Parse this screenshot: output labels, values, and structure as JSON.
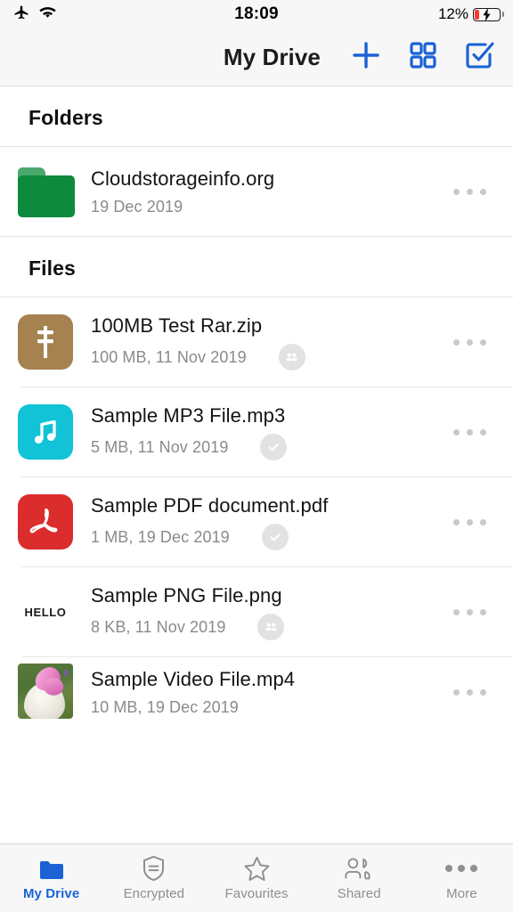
{
  "status_bar": {
    "airplane_icon": "airplane-icon",
    "wifi_icon": "wifi-icon",
    "time": "18:09",
    "battery_percent": "12%",
    "battery_icon": "battery-charging-icon",
    "battery_low_color": "#fb3b2f"
  },
  "navbar": {
    "title": "My Drive",
    "add_icon": "plus-icon",
    "grid_icon": "grid-view-icon",
    "select_icon": "select-checkbox-icon",
    "accent_color": "#1a62d6"
  },
  "sections": [
    {
      "id": "folders",
      "title": "Folders"
    },
    {
      "id": "files",
      "title": "Files"
    }
  ],
  "folders": [
    {
      "name": "Cloudstorageinfo.org",
      "subtitle": "19 Dec 2019",
      "icon": "folder-icon",
      "icon_color": "#0d8a3e",
      "menu_icon": "overflow-menu-icon"
    }
  ],
  "files": [
    {
      "name": "100MB Test Rar.zip",
      "subtitle": "100 MB, 11 Nov 2019",
      "size": "100 MB",
      "date": "11 Nov 2019",
      "icon": "zip-file-icon",
      "icon_color": "#a5824f",
      "status_badge": "shared-users-badge",
      "menu_icon": "overflow-menu-icon"
    },
    {
      "name": "Sample MP3 File.mp3",
      "subtitle": "5 MB, 11 Nov 2019",
      "size": "5 MB",
      "date": "11 Nov 2019",
      "icon": "audio-file-icon",
      "icon_color": "#12c2d6",
      "status_badge": "synced-check-badge",
      "menu_icon": "overflow-menu-icon"
    },
    {
      "name": "Sample PDF document.pdf",
      "subtitle": "1 MB, 19 Dec 2019",
      "size": "1 MB",
      "date": "19 Dec 2019",
      "icon": "pdf-file-icon",
      "icon_color": "#dc2d2d",
      "status_badge": "synced-check-badge",
      "menu_icon": "overflow-menu-icon"
    },
    {
      "name": "Sample PNG File.png",
      "subtitle": "8 KB, 11 Nov 2019",
      "size": "8 KB",
      "date": "11 Nov 2019",
      "icon": "image-thumbnail",
      "thumbnail_text": "HELLO",
      "status_badge": "shared-users-badge",
      "menu_icon": "overflow-menu-icon"
    },
    {
      "name": "Sample Video File.mp4",
      "subtitle": "10 MB, 19 Dec 2019",
      "size": "10 MB",
      "date": "19 Dec 2019",
      "icon": "video-thumbnail",
      "menu_icon": "overflow-menu-icon"
    }
  ],
  "tabbar": {
    "items": [
      {
        "label": "My Drive",
        "icon": "folder-icon",
        "active": true
      },
      {
        "label": "Encrypted",
        "icon": "shield-icon",
        "active": false
      },
      {
        "label": "Favourites",
        "icon": "star-icon",
        "active": false
      },
      {
        "label": "Shared",
        "icon": "people-icon",
        "active": false
      },
      {
        "label": "More",
        "icon": "more-dots-icon",
        "active": false
      }
    ]
  }
}
